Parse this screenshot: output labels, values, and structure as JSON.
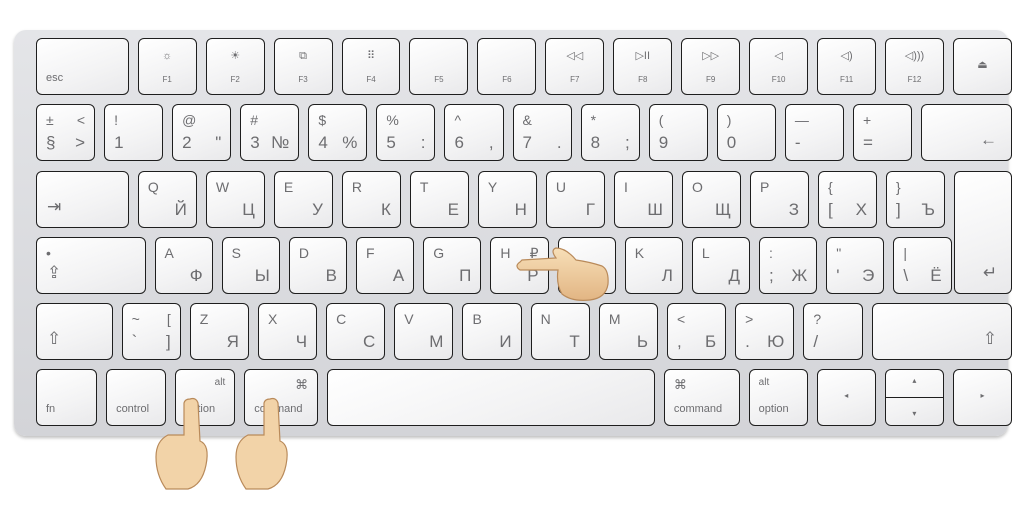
{
  "keyboard": {
    "rows": [
      [
        {
          "bl": "esc"
        },
        {
          "icon": "brightness-down",
          "fc": "F1"
        },
        {
          "icon": "brightness-up",
          "fc": "F2"
        },
        {
          "icon": "mission-control",
          "fc": "F3"
        },
        {
          "icon": "launchpad",
          "fc": "F4"
        },
        {
          "fc": "F5"
        },
        {
          "fc": "F6"
        },
        {
          "icon": "rewind",
          "fc": "F7"
        },
        {
          "icon": "play-pause",
          "fc": "F8"
        },
        {
          "icon": "fast-forward",
          "fc": "F9"
        },
        {
          "icon": "mute",
          "fc": "F10"
        },
        {
          "icon": "volume-down",
          "fc": "F11"
        },
        {
          "icon": "volume-up",
          "fc": "F12"
        },
        {
          "icon": "eject"
        }
      ],
      [
        {
          "tl": "±",
          "bl": "§",
          "tr": "<",
          "br": ">"
        },
        {
          "tl": "!",
          "bl": "1"
        },
        {
          "tl": "@",
          "bl": "2",
          "br": "\""
        },
        {
          "tl": "#",
          "bl": "3",
          "br": "№"
        },
        {
          "tl": "$",
          "bl": "4",
          "br": "%"
        },
        {
          "tl": "%",
          "bl": "5",
          "br": ":"
        },
        {
          "tl": "^",
          "bl": "6",
          "br": ","
        },
        {
          "tl": "&",
          "bl": "7",
          "br": "."
        },
        {
          "tl": "*",
          "bl": "8",
          "br": ";"
        },
        {
          "tl": "(",
          "bl": "9"
        },
        {
          "tl": ")",
          "bl": "0"
        },
        {
          "tl": "—",
          "bl": "-"
        },
        {
          "tl": "+",
          "bl": "="
        },
        {
          "icon": "backspace"
        }
      ],
      [
        {
          "icon": "tab"
        },
        {
          "tl": "Q",
          "br": "Й"
        },
        {
          "tl": "W",
          "br": "Ц"
        },
        {
          "tl": "E",
          "br": "У"
        },
        {
          "tl": "R",
          "br": "К"
        },
        {
          "tl": "T",
          "br": "Е"
        },
        {
          "tl": "Y",
          "br": "Н"
        },
        {
          "tl": "U",
          "br": "Г"
        },
        {
          "tl": "I",
          "br": "Ш"
        },
        {
          "tl": "O",
          "br": "Щ"
        },
        {
          "tl": "P",
          "br": "З"
        },
        {
          "tl": "{",
          "bl": "[",
          "br": "Х"
        },
        {
          "tl": "}",
          "bl": "]",
          "br": "Ъ"
        },
        {
          "icon": "return"
        }
      ],
      [
        {
          "tl": "•",
          "icon": "caps-lock"
        },
        {
          "tl": "A",
          "br": "Ф"
        },
        {
          "tl": "S",
          "br": "Ы"
        },
        {
          "tl": "D",
          "br": "В"
        },
        {
          "tl": "F",
          "br": "А"
        },
        {
          "tl": "G",
          "br": "П"
        },
        {
          "tl": "H",
          "tr": "₽",
          "br": "Р"
        },
        {},
        {
          "tl": "K",
          "br": "Л"
        },
        {
          "tl": "L",
          "br": "Д"
        },
        {
          "tl": ":",
          "bl": ";",
          "br": "Ж"
        },
        {
          "tl": "\"",
          "bl": "'",
          "br": "Э"
        },
        {
          "tl": "|",
          "bl": "\\",
          "br": "Ё"
        },
        {
          "icon": "enter"
        }
      ],
      [
        {
          "icon": "shift"
        },
        {
          "tl": "~",
          "bl": "`",
          "tr": "[",
          "br": "]"
        },
        {
          "tl": "Z",
          "br": "Я"
        },
        {
          "tl": "X",
          "br": "Ч"
        },
        {
          "tl": "C",
          "br": "С"
        },
        {
          "tl": "V",
          "br": "М"
        },
        {
          "tl": "B",
          "br": "И"
        },
        {
          "tl": "N",
          "br": "Т"
        },
        {
          "tl": "M",
          "br": "Ь"
        },
        {
          "tl": "<",
          "bl": ",",
          "br": "Б"
        },
        {
          "tl": ">",
          "bl": ".",
          "br": "Ю"
        },
        {
          "tl": "?",
          "bl": "/"
        },
        {
          "icon": "shift"
        }
      ],
      [
        {
          "bl": "fn"
        },
        {
          "bl": "control"
        },
        {
          "tr": "alt",
          "bl": "option"
        },
        {
          "icon": "command",
          "bl": "command"
        },
        {},
        {
          "icon": "command",
          "bl": "command"
        },
        {
          "tl": "alt",
          "bl": "option"
        },
        {
          "icon": "arrow-left"
        },
        {
          "icon": "arrow-up-down"
        },
        {
          "icon": "arrow-right"
        }
      ]
    ]
  },
  "colors": {
    "key": "#f5f5f6",
    "key_border": "#1e1e1e",
    "body": "#d9dadd",
    "legend": "#6d6d70",
    "skin": "#f2d3a8"
  }
}
